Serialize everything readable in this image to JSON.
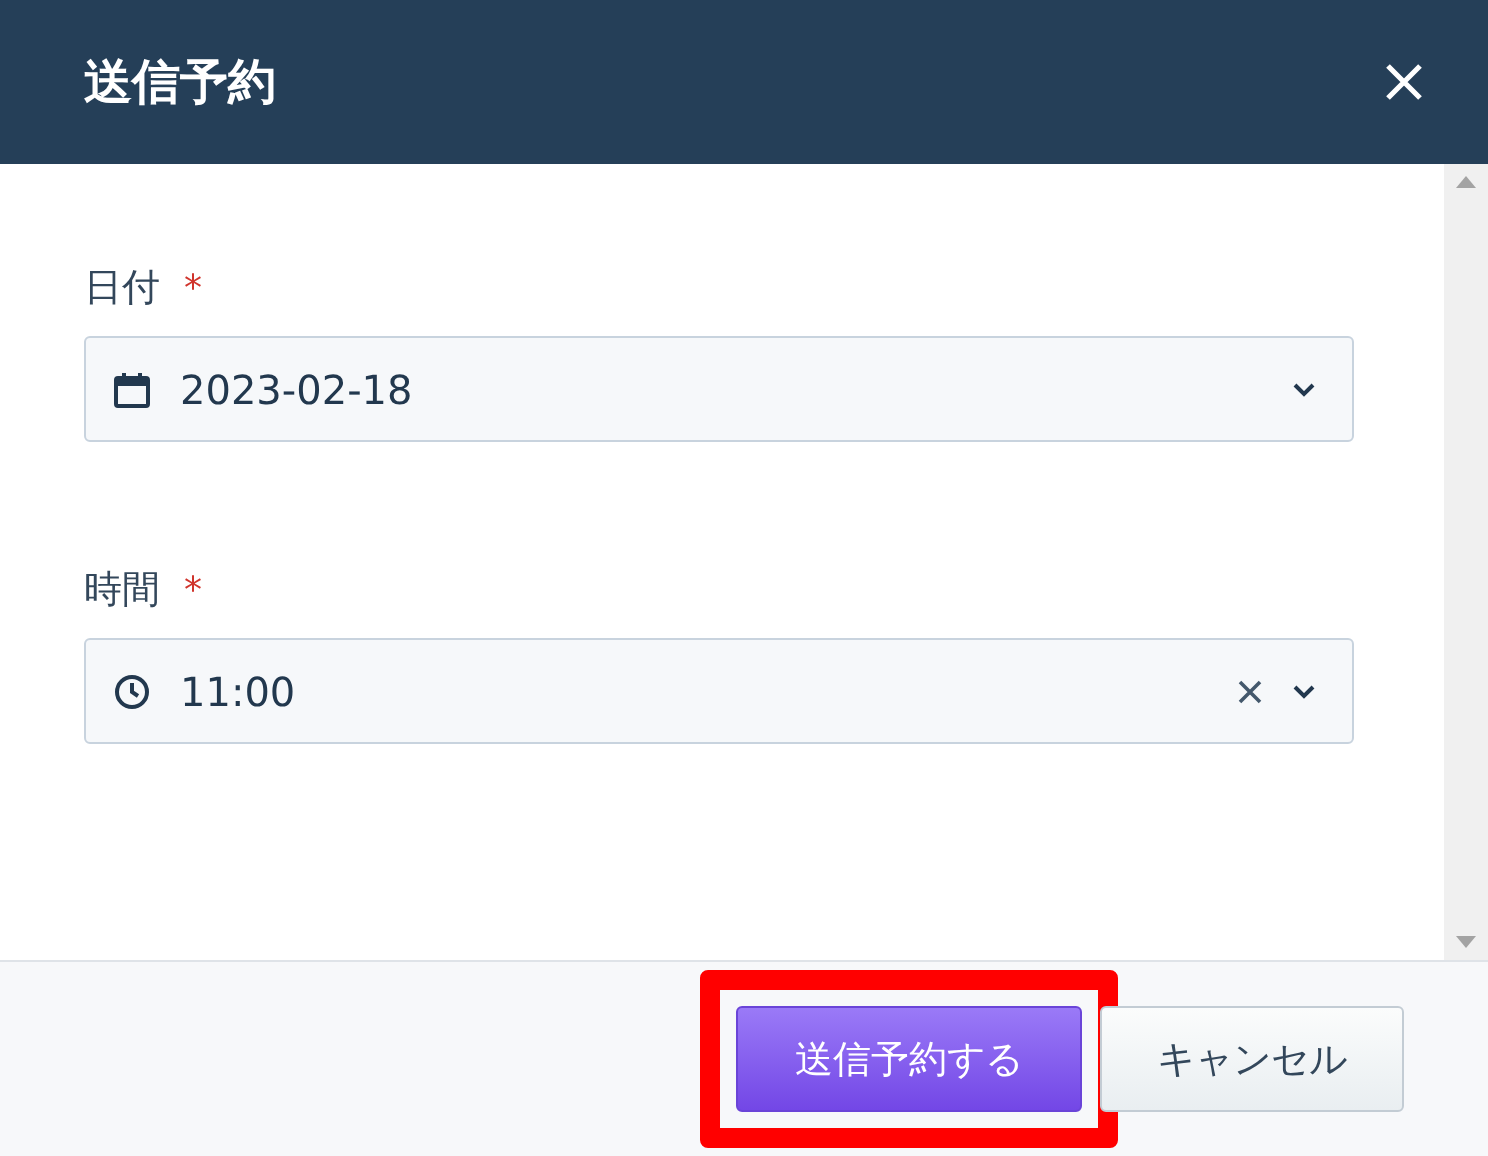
{
  "dialog": {
    "title": "送信予約"
  },
  "fields": [
    {
      "kind": "date",
      "label": "日付",
      "required": true,
      "required_mark": "*",
      "value": "2023-02-18",
      "clearable": false
    },
    {
      "kind": "time",
      "label": "時間",
      "required": true,
      "required_mark": "*",
      "value": "11:00",
      "clearable": true
    }
  ],
  "buttons": [
    {
      "kind": "primary",
      "label": "送信予約する",
      "highlighted": true
    },
    {
      "kind": "secondary",
      "label": "キャンセル",
      "highlighted": false
    }
  ]
}
